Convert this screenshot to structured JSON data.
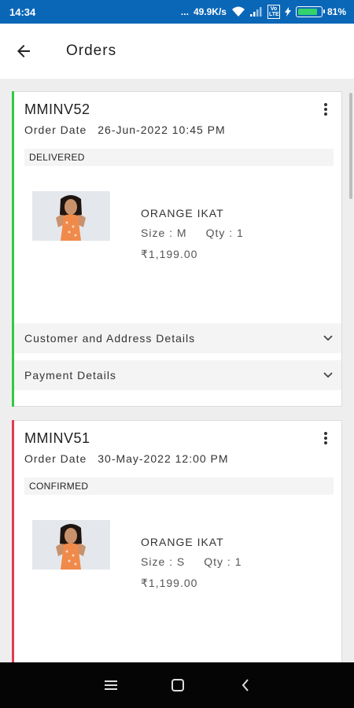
{
  "status_bar": {
    "time": "14:34",
    "dots": "...",
    "net_speed": "49.9K/s",
    "volte": "Vo LTE",
    "battery": "81%",
    "battery_level": 0.81
  },
  "app_bar": {
    "title": "Orders"
  },
  "orders": [
    {
      "id": "MMINV52",
      "date_label": "Order Date",
      "date_value": "26-Jun-2022 10:45 PM",
      "status": "DELIVERED",
      "status_color": "#2ecc40",
      "product": {
        "name": "ORANGE IKAT",
        "size": "Size : M",
        "qty": "Qty : 1",
        "price": "₹1,199.00"
      },
      "sections": [
        "Customer and Address Details",
        "Payment Details"
      ]
    },
    {
      "id": "MMINV51",
      "date_label": "Order Date",
      "date_value": "30-May-2022 12:00 PM",
      "status": "CONFIRMED",
      "status_color": "#e53950",
      "product": {
        "name": "ORANGE IKAT",
        "size": "Size : S",
        "qty": "Qty : 1",
        "price": "₹1,199.00"
      }
    }
  ]
}
